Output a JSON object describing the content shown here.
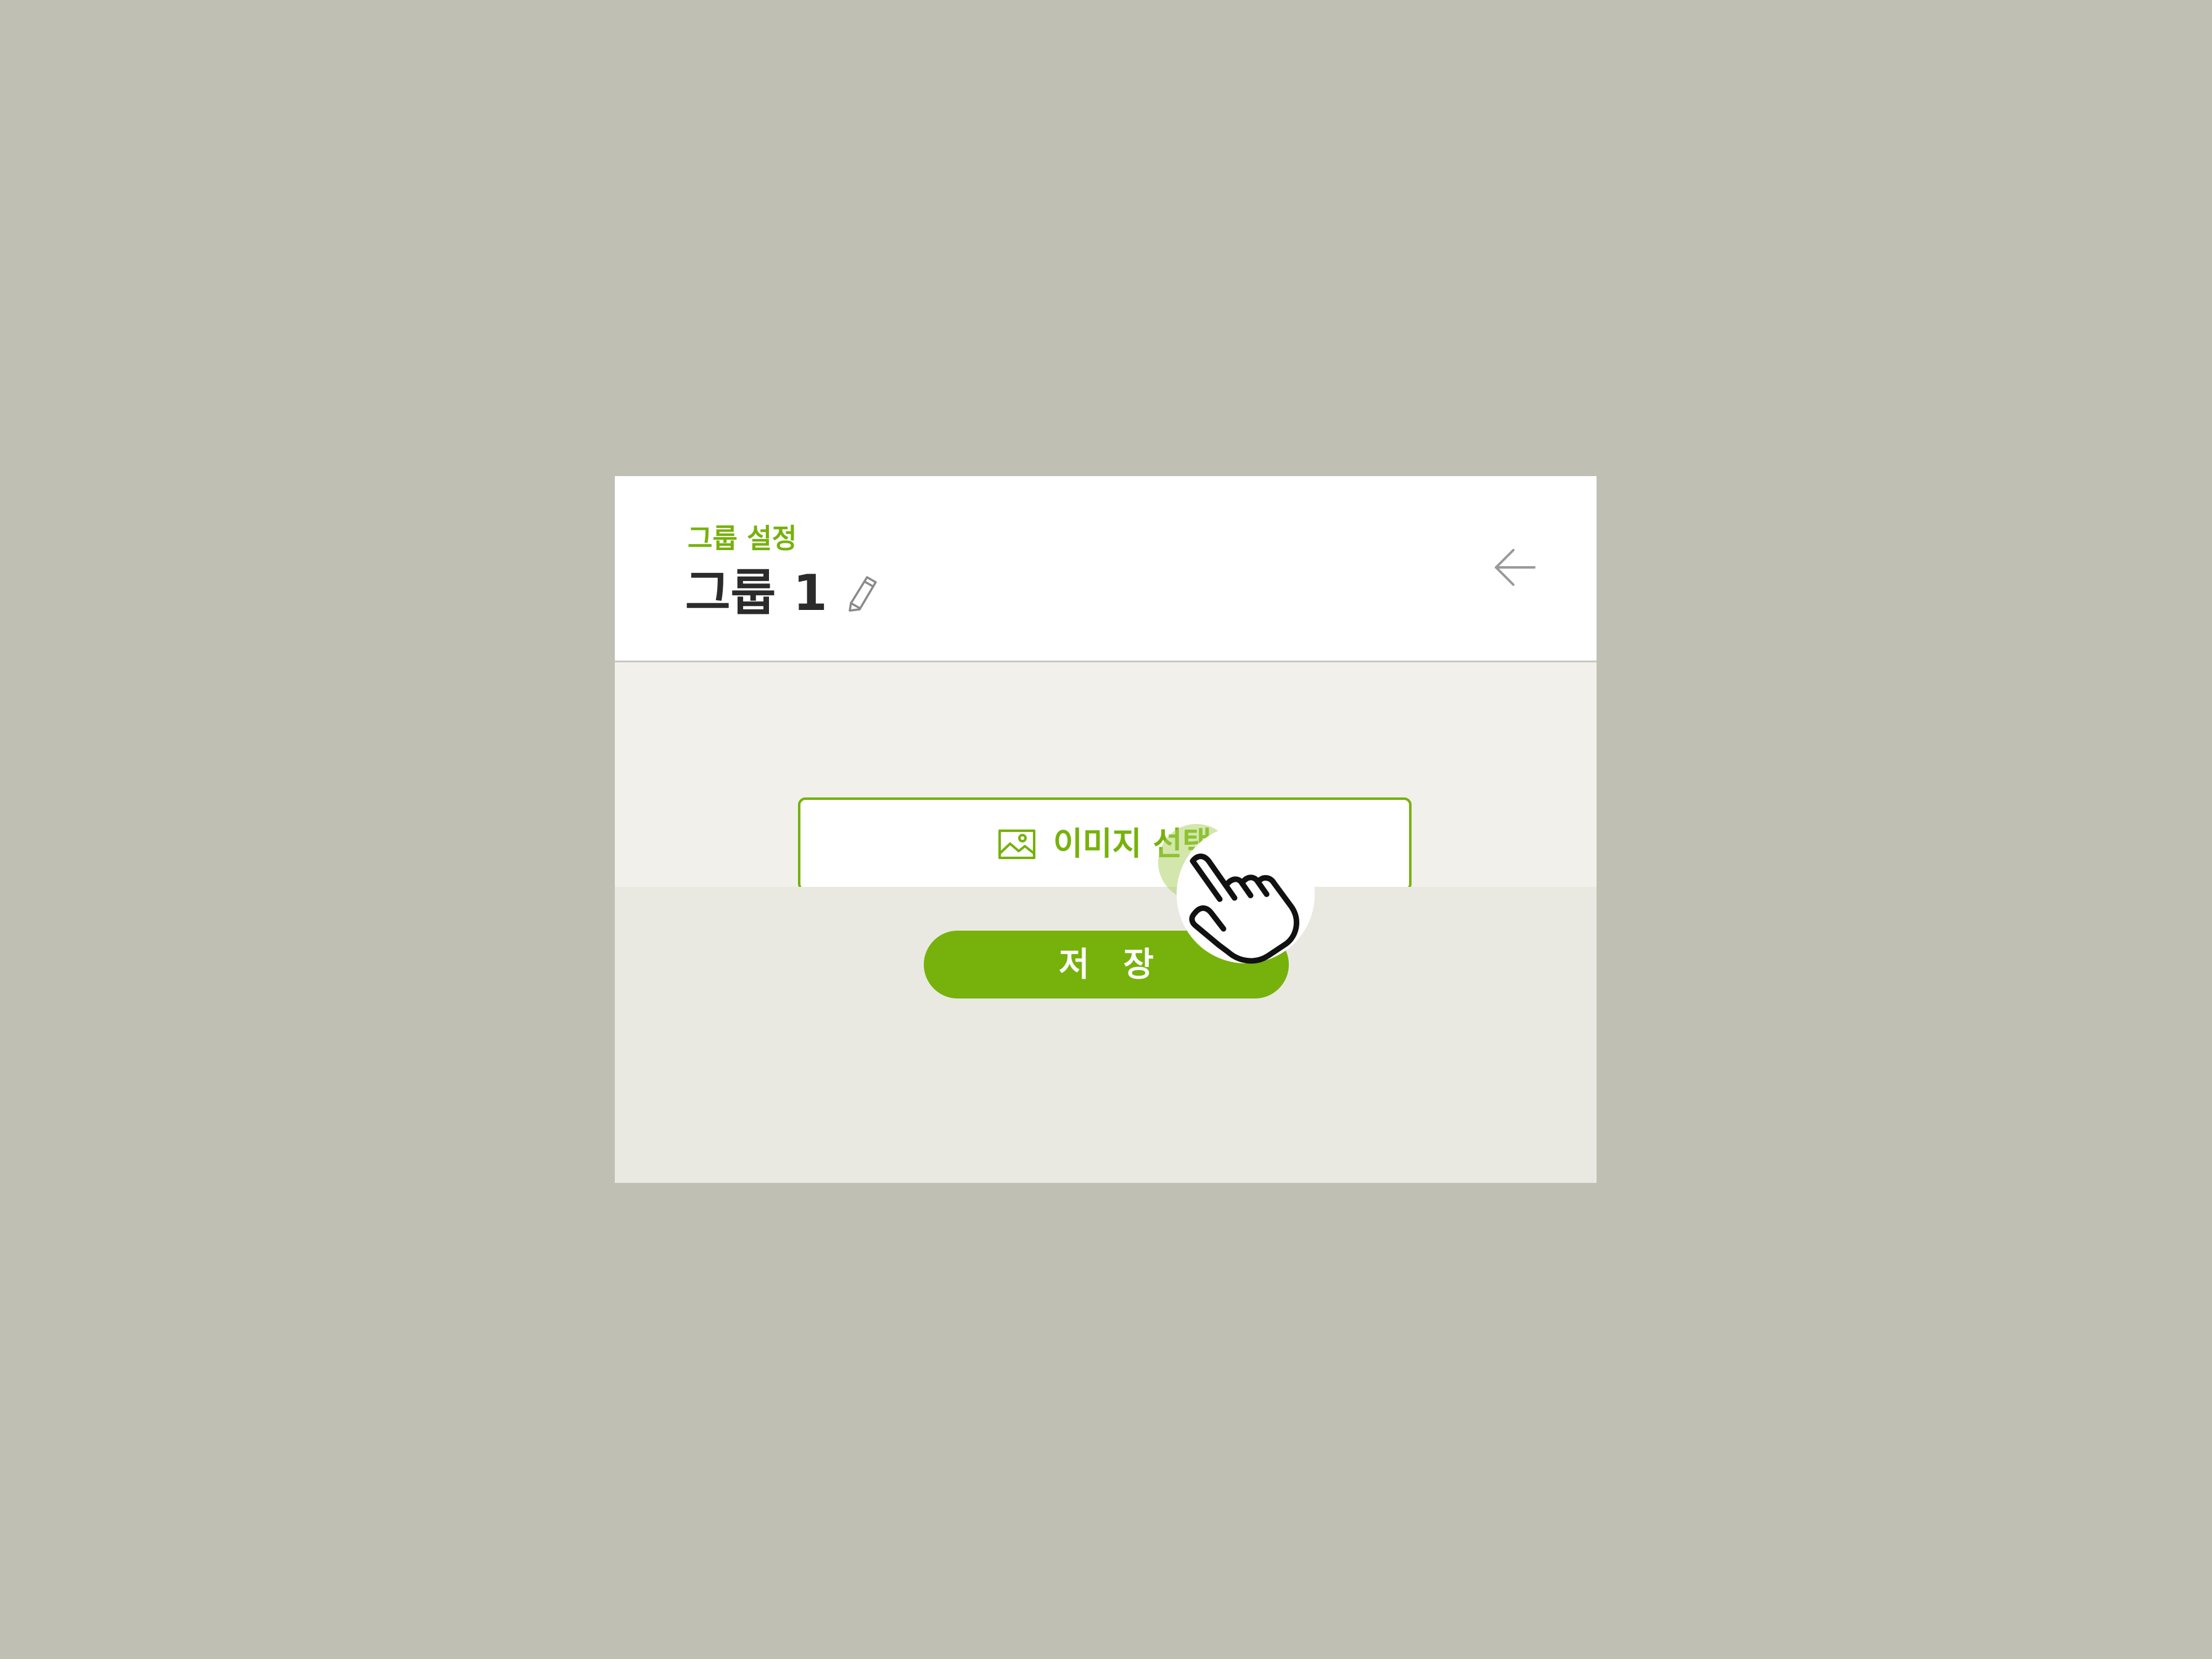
{
  "header": {
    "subtitle": "그룹 설정",
    "title": "그룹 1",
    "edit_icon": "pencil-icon",
    "back_icon": "arrow-left-icon"
  },
  "main": {
    "select_image_label": "이미지 선택",
    "select_image_icon": "image-icon"
  },
  "footer": {
    "save_label": "저 장"
  },
  "overlay": {
    "cursor_icon": "pointing-hand-cursor-icon"
  },
  "colors": {
    "accent": "#76b20b",
    "background": "#bfc0b3",
    "panel": "#ffffff",
    "body": "#f1f0eb",
    "footer": "#e9e9e2",
    "title_text": "#2b2b2b"
  }
}
